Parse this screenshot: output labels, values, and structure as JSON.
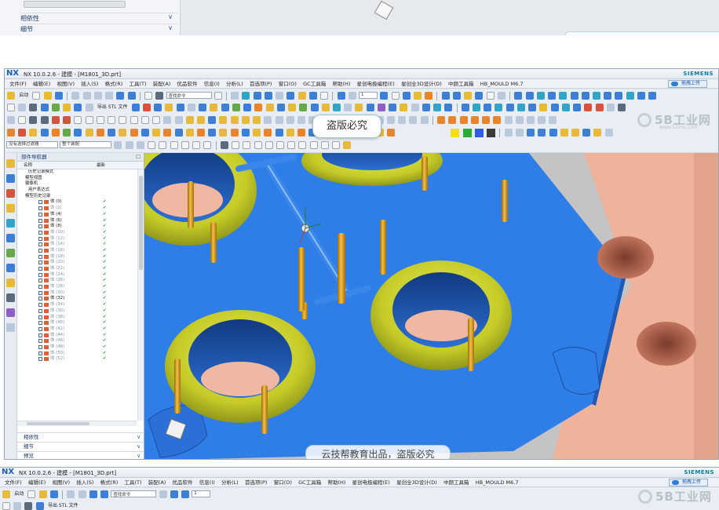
{
  "top_fragment": {
    "sections": [
      "相依性",
      "细节"
    ]
  },
  "window": {
    "logo": "NX",
    "title": "NX 10.0.2.6 - 建模 - [M1801_3D.prt]",
    "brand": "SIEMENS",
    "upload_label": "拖拽上传"
  },
  "menu": [
    "文件(F)",
    "编辑(E)",
    "视图(V)",
    "插入(S)",
    "格式(R)",
    "工具(T)",
    "装配(A)",
    "优品软件",
    "信息(I)",
    "分析(L)",
    "首选项(P)",
    "窗口(O)",
    "GC工具箱",
    "帮助(H)",
    "星创电极编程(E)",
    "星创全3D设计(D)",
    "中颜工具箱",
    "HB_MOULD M6.7"
  ],
  "toolbar": {
    "start_label": "启动",
    "search_placeholder": "查找命令",
    "export_stl_label": "导出 STL 文件",
    "layer_value": "1",
    "selection_filter": "没有选择过滤器",
    "assembly_scope": "整个装配",
    "swatch_colors": [
      "#f2df1c",
      "#2daa3a",
      "#2f5fe0",
      "#3b3b3b"
    ]
  },
  "tooltip": "盗版必究",
  "brand_watermark": {
    "text": "5B工业网",
    "url": "www.52cnc.com"
  },
  "navigator": {
    "title": "部件导航器",
    "col_name": "名称",
    "col_latest": "最新",
    "items": [
      {
        "label": "历史记录模式",
        "indent": 6,
        "type": "plain"
      },
      {
        "label": "模型视图",
        "indent": 2,
        "type": "plain"
      },
      {
        "label": "摄像机",
        "indent": 2,
        "type": "plain"
      },
      {
        "label": "用户表达式",
        "indent": 6,
        "type": "plain"
      },
      {
        "label": "模型历史记录",
        "indent": 2,
        "type": "plain"
      },
      {
        "label": "体 (0)",
        "indent": 40,
        "type": "body",
        "dim": false
      },
      {
        "label": "体 (2)",
        "indent": 40,
        "type": "body",
        "dim": true
      },
      {
        "label": "体 (4)",
        "indent": 40,
        "type": "body",
        "dim": false
      },
      {
        "label": "体 (6)",
        "indent": 40,
        "type": "body",
        "dim": false
      },
      {
        "label": "体 (8)",
        "indent": 40,
        "type": "body",
        "dim": false
      },
      {
        "label": "体 (10)",
        "indent": 40,
        "type": "body",
        "dim": true
      },
      {
        "label": "体 (12)",
        "indent": 40,
        "type": "body",
        "dim": true
      },
      {
        "label": "体 (14)",
        "indent": 40,
        "type": "body",
        "dim": true
      },
      {
        "label": "体 (16)",
        "indent": 40,
        "type": "body",
        "dim": true
      },
      {
        "label": "体 (18)",
        "indent": 40,
        "type": "body",
        "dim": true
      },
      {
        "label": "体 (20)",
        "indent": 40,
        "type": "body",
        "dim": true
      },
      {
        "label": "体 (22)",
        "indent": 40,
        "type": "body",
        "dim": true
      },
      {
        "label": "体 (24)",
        "indent": 40,
        "type": "body",
        "dim": true
      },
      {
        "label": "体 (26)",
        "indent": 40,
        "type": "body",
        "dim": true
      },
      {
        "label": "体 (28)",
        "indent": 40,
        "type": "body",
        "dim": true
      },
      {
        "label": "体 (30)",
        "indent": 40,
        "type": "body",
        "dim": true
      },
      {
        "label": "体 (32)",
        "indent": 40,
        "type": "body",
        "dim": false
      },
      {
        "label": "体 (34)",
        "indent": 40,
        "type": "body",
        "dim": true
      },
      {
        "label": "体 (36)",
        "indent": 40,
        "type": "body",
        "dim": true
      },
      {
        "label": "体 (38)",
        "indent": 40,
        "type": "body",
        "dim": true
      },
      {
        "label": "体 (40)",
        "indent": 40,
        "type": "body",
        "dim": true
      },
      {
        "label": "体 (42)",
        "indent": 40,
        "type": "body",
        "dim": true
      },
      {
        "label": "体 (44)",
        "indent": 40,
        "type": "body",
        "dim": true
      },
      {
        "label": "体 (46)",
        "indent": 40,
        "type": "body",
        "dim": true
      },
      {
        "label": "体 (48)",
        "indent": 40,
        "type": "body",
        "dim": true
      },
      {
        "label": "体 (50)",
        "indent": 40,
        "type": "body",
        "dim": true
      },
      {
        "label": "体 (52)",
        "indent": 40,
        "type": "body",
        "dim": true
      }
    ],
    "sections": [
      "相依性",
      "细节",
      "预览"
    ]
  },
  "viewport_watermark": "云技帮教育出品，盗版必究",
  "colors": {
    "plate": "#2f7ee8",
    "plate_edge": "#1e5bb8",
    "insert_block": "#f2b8a2",
    "ring": "#c5cc28",
    "ring_dark": "#8f961a",
    "pin": "#d89a12",
    "background": "#c4c4c4"
  }
}
